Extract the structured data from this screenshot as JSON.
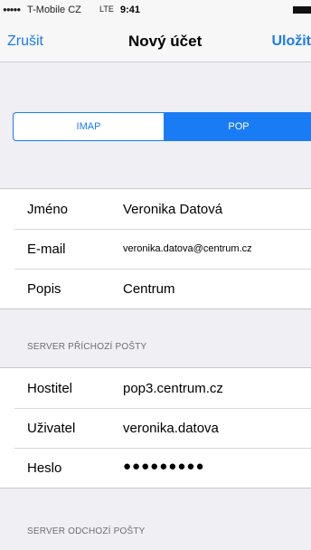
{
  "status_bar": {
    "signal": "●●●●●",
    "carrier": "T-Mobile CZ",
    "network": "LTE",
    "time": "9:41"
  },
  "nav": {
    "cancel_label": "Zrušit",
    "title": "Nový účet",
    "save_label": "Uložit"
  },
  "segmented": {
    "options": [
      "IMAP",
      "POP"
    ],
    "selected": "POP"
  },
  "account": {
    "name_label": "Jméno",
    "name_value": "Veronika Datová",
    "email_label": "E-mail",
    "email_value": "veronika.datova@centrum.cz",
    "description_label": "Popis",
    "description_value": "Centrum"
  },
  "incoming": {
    "header": "SERVER PŘÍCHOZÍ POŠTY",
    "host_label": "Hostitel",
    "host_value": "pop3.centrum.cz",
    "user_label": "Uživatel",
    "user_value": "veronika.datova",
    "password_label": "Heslo",
    "password_value": "●●●●●●●●●"
  },
  "outgoing": {
    "header": "SERVER ODCHOZÍ POŠTY"
  },
  "colors": {
    "accent": "#1a7cf5",
    "background": "#efeff4",
    "brand_pink": "#e0006e"
  }
}
